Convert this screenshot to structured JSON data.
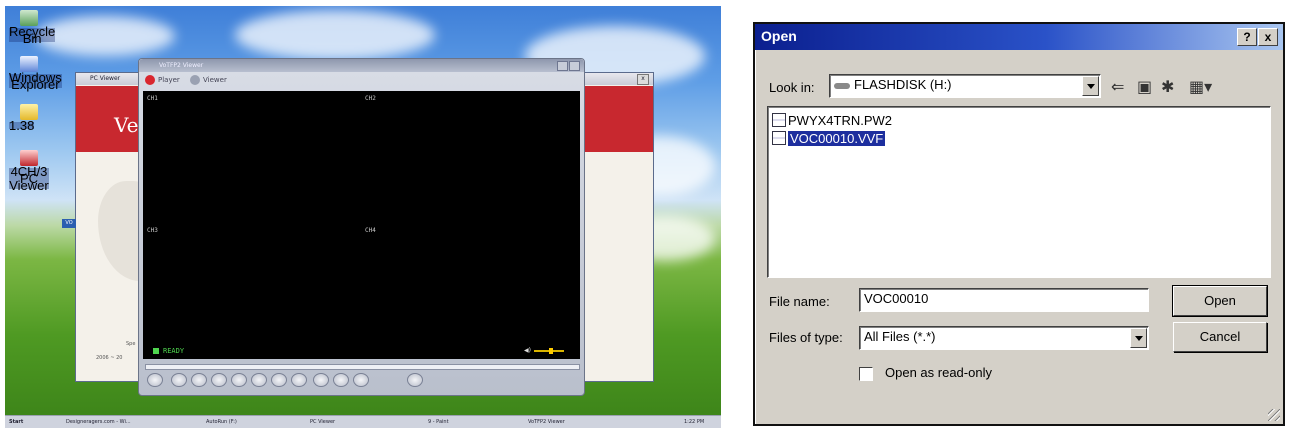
{
  "desktop": {
    "icons": [
      {
        "label": "Recycle Bin",
        "icon": "recycle-bin-icon"
      },
      {
        "label": "Windows Explorer",
        "icon": "explorer-icon"
      },
      {
        "label": "1.38",
        "icon": "folder-icon"
      },
      {
        "label": "4CH/3 PC Viewer",
        "icon": "pc-viewer-app-icon"
      }
    ],
    "pc_viewer_window": {
      "title": "PC Viewer",
      "brand_text": "Ve",
      "footer_text_1": "Spe",
      "footer_text_2": "2006 ~ 20",
      "side_badge": "VO",
      "close_glyph": "x"
    },
    "vot_viewer_window": {
      "title": "VoTFP2 Viewer",
      "mode_player": "Player",
      "mode_viewer": "Viewer",
      "channels": [
        "CH1",
        "CH2",
        "CH3",
        "CH4"
      ],
      "status": "READY",
      "volume_level": 0.55
    },
    "taskbar": {
      "start_label": "Start",
      "items": [
        "Designeragers.com - Wi...",
        "AutoRun (F:)",
        "PC Viewer",
        "9 - Paint",
        "VoTFP2 Viewer"
      ],
      "clock": "1:22 PM"
    }
  },
  "dialog": {
    "title": "Open",
    "help_glyph": "?",
    "close_glyph": "x",
    "look_in_label": "Look in:",
    "look_in_value": "FLASHDISK (H:)",
    "toolbar_icons": [
      "back-arrow-icon",
      "up-folder-icon",
      "new-folder-icon",
      "view-menu-icon"
    ],
    "files": [
      {
        "name": "PWYX4TRN.PW2",
        "selected": false
      },
      {
        "name": "VOC00010.VVF",
        "selected": true
      }
    ],
    "file_name_label": "File name:",
    "file_name_value": "VOC00010",
    "file_type_label": "Files of type:",
    "file_type_value": "All Files (*.*)",
    "open_button": "Open",
    "cancel_button": "Cancel",
    "read_only_label": "Open as read-only",
    "read_only_checked": false
  }
}
